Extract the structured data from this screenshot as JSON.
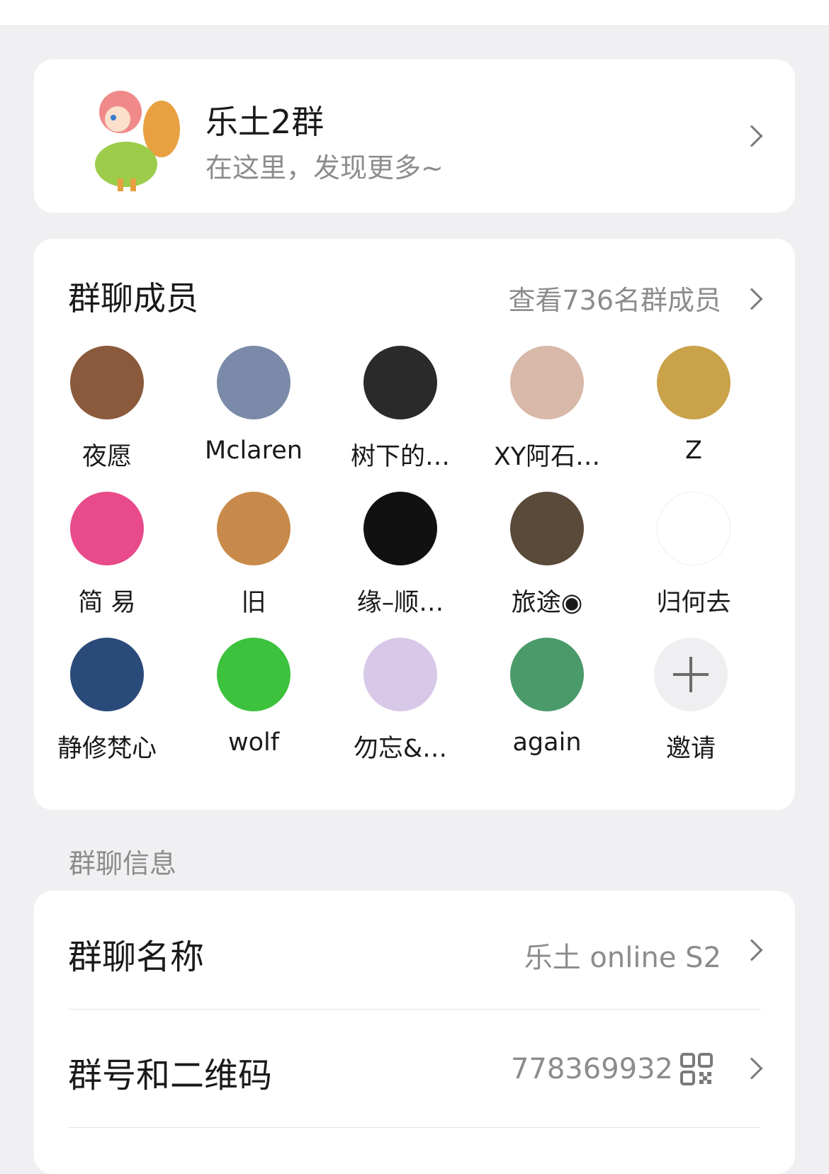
{
  "group": {
    "name": "乐土2群",
    "subtitle": "在这里，发现更多~"
  },
  "members_section": {
    "title": "群聊成员",
    "view_all": "查看736名群成员",
    "members": [
      {
        "name": "夜愿",
        "color": "#8b5a3c"
      },
      {
        "name": "Mclaren",
        "color": "#7a8aa8"
      },
      {
        "name": "树下的…",
        "color": "#2a2a2a"
      },
      {
        "name": "XY阿石…",
        "color": "#d8b8a8"
      },
      {
        "name": "Z",
        "color": "#c9a24a"
      },
      {
        "name": "简 易",
        "color": "#e84a8a"
      },
      {
        "name": "旧",
        "color": "#c88a4a"
      },
      {
        "name": "缘–顺…",
        "color": "#111111"
      },
      {
        "name": "旅途◉",
        "color": "#5a4a3a"
      },
      {
        "name": "归何去",
        "color": "#ffffff"
      },
      {
        "name": "静修梵心",
        "color": "#2a4a7a"
      },
      {
        "name": "wolf",
        "color": "#3cc23c"
      },
      {
        "name": "勿忘&…",
        "color": "#d8c8e8"
      },
      {
        "name": "again",
        "color": "#4a9a6a"
      }
    ],
    "invite_label": "邀请"
  },
  "info_section": {
    "label": "群聊信息",
    "name_row": {
      "label": "群聊名称",
      "value": "乐土 online S2"
    },
    "qr_row": {
      "label": "群号和二维码",
      "value": "778369932"
    }
  }
}
